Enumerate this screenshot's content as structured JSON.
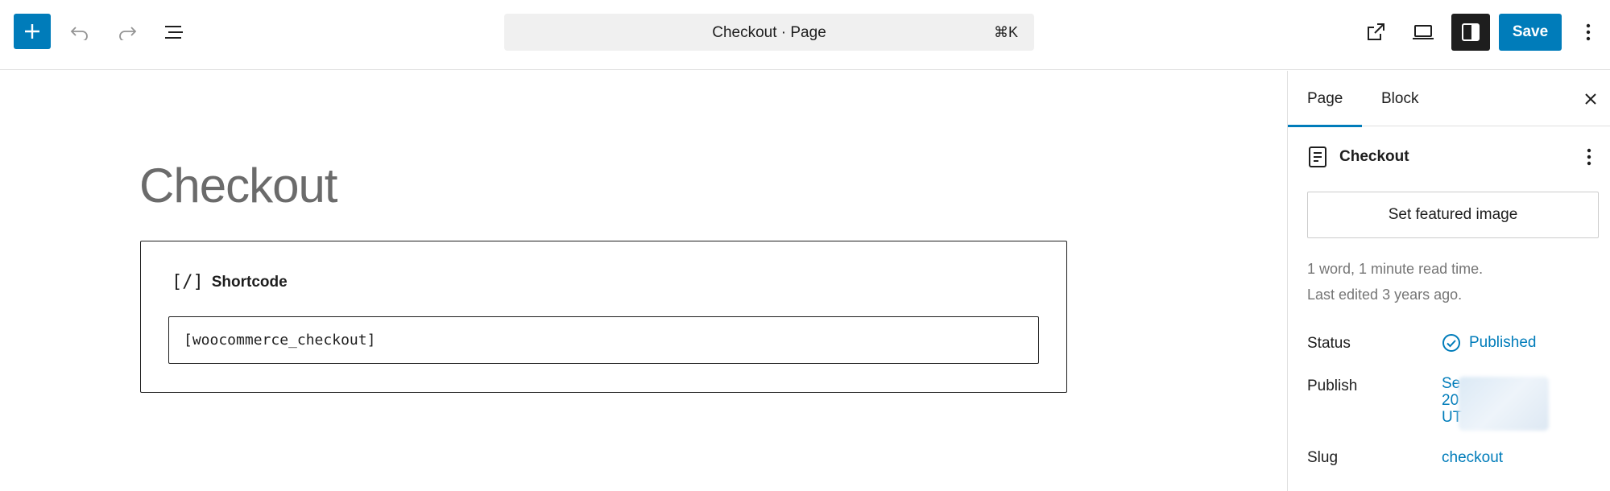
{
  "toolbar": {
    "add_icon": "plus-icon",
    "undo_icon": "undo-icon",
    "redo_icon": "redo-icon",
    "list_view_icon": "list-view-icon",
    "command_title": "Checkout · Page",
    "command_shortcut": "⌘K",
    "view_external_icon": "external-link-icon",
    "preview_icon": "desktop-preview-icon",
    "settings_icon": "sidebar-toggle-icon",
    "save_label": "Save",
    "options_icon": "vertical-dots-icon"
  },
  "editor": {
    "post_title": "Checkout",
    "block": {
      "icon_text": "[/]",
      "label": "Shortcode",
      "value": "[woocommerce_checkout]"
    }
  },
  "sidebar": {
    "tabs": [
      {
        "label": "Page",
        "active": true
      },
      {
        "label": "Block",
        "active": false
      }
    ],
    "document": {
      "title": "Checkout",
      "icon": "page-icon"
    },
    "featured_image_label": "Set featured image",
    "stats_line": "1 word, 1 minute read time.",
    "last_edited": "Last edited 3 years ago.",
    "fields": {
      "status_label": "Status",
      "status_value": "Published",
      "publish_label": "Publish",
      "publish_value_line1": "Se",
      "publish_value_line2": "20",
      "publish_value_line3": "UT",
      "slug_label": "Slug",
      "slug_value": "checkout"
    }
  },
  "colors": {
    "accent": "#007cba",
    "dark": "#1e1e1e",
    "muted": "#757575"
  }
}
